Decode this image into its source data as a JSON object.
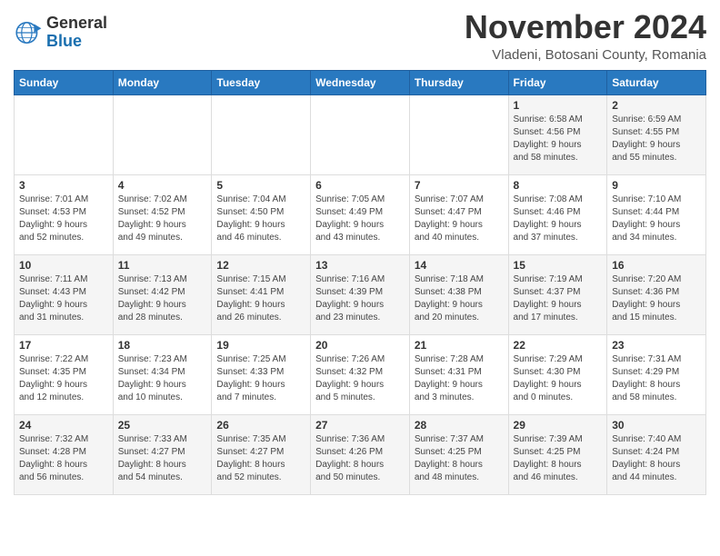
{
  "header": {
    "logo_text_general": "General",
    "logo_text_blue": "Blue",
    "month_title": "November 2024",
    "location": "Vladeni, Botosani County, Romania"
  },
  "days_of_week": [
    "Sunday",
    "Monday",
    "Tuesday",
    "Wednesday",
    "Thursday",
    "Friday",
    "Saturday"
  ],
  "weeks": [
    [
      {
        "day": "",
        "info": ""
      },
      {
        "day": "",
        "info": ""
      },
      {
        "day": "",
        "info": ""
      },
      {
        "day": "",
        "info": ""
      },
      {
        "day": "",
        "info": ""
      },
      {
        "day": "1",
        "info": "Sunrise: 6:58 AM\nSunset: 4:56 PM\nDaylight: 9 hours\nand 58 minutes."
      },
      {
        "day": "2",
        "info": "Sunrise: 6:59 AM\nSunset: 4:55 PM\nDaylight: 9 hours\nand 55 minutes."
      }
    ],
    [
      {
        "day": "3",
        "info": "Sunrise: 7:01 AM\nSunset: 4:53 PM\nDaylight: 9 hours\nand 52 minutes."
      },
      {
        "day": "4",
        "info": "Sunrise: 7:02 AM\nSunset: 4:52 PM\nDaylight: 9 hours\nand 49 minutes."
      },
      {
        "day": "5",
        "info": "Sunrise: 7:04 AM\nSunset: 4:50 PM\nDaylight: 9 hours\nand 46 minutes."
      },
      {
        "day": "6",
        "info": "Sunrise: 7:05 AM\nSunset: 4:49 PM\nDaylight: 9 hours\nand 43 minutes."
      },
      {
        "day": "7",
        "info": "Sunrise: 7:07 AM\nSunset: 4:47 PM\nDaylight: 9 hours\nand 40 minutes."
      },
      {
        "day": "8",
        "info": "Sunrise: 7:08 AM\nSunset: 4:46 PM\nDaylight: 9 hours\nand 37 minutes."
      },
      {
        "day": "9",
        "info": "Sunrise: 7:10 AM\nSunset: 4:44 PM\nDaylight: 9 hours\nand 34 minutes."
      }
    ],
    [
      {
        "day": "10",
        "info": "Sunrise: 7:11 AM\nSunset: 4:43 PM\nDaylight: 9 hours\nand 31 minutes."
      },
      {
        "day": "11",
        "info": "Sunrise: 7:13 AM\nSunset: 4:42 PM\nDaylight: 9 hours\nand 28 minutes."
      },
      {
        "day": "12",
        "info": "Sunrise: 7:15 AM\nSunset: 4:41 PM\nDaylight: 9 hours\nand 26 minutes."
      },
      {
        "day": "13",
        "info": "Sunrise: 7:16 AM\nSunset: 4:39 PM\nDaylight: 9 hours\nand 23 minutes."
      },
      {
        "day": "14",
        "info": "Sunrise: 7:18 AM\nSunset: 4:38 PM\nDaylight: 9 hours\nand 20 minutes."
      },
      {
        "day": "15",
        "info": "Sunrise: 7:19 AM\nSunset: 4:37 PM\nDaylight: 9 hours\nand 17 minutes."
      },
      {
        "day": "16",
        "info": "Sunrise: 7:20 AM\nSunset: 4:36 PM\nDaylight: 9 hours\nand 15 minutes."
      }
    ],
    [
      {
        "day": "17",
        "info": "Sunrise: 7:22 AM\nSunset: 4:35 PM\nDaylight: 9 hours\nand 12 minutes."
      },
      {
        "day": "18",
        "info": "Sunrise: 7:23 AM\nSunset: 4:34 PM\nDaylight: 9 hours\nand 10 minutes."
      },
      {
        "day": "19",
        "info": "Sunrise: 7:25 AM\nSunset: 4:33 PM\nDaylight: 9 hours\nand 7 minutes."
      },
      {
        "day": "20",
        "info": "Sunrise: 7:26 AM\nSunset: 4:32 PM\nDaylight: 9 hours\nand 5 minutes."
      },
      {
        "day": "21",
        "info": "Sunrise: 7:28 AM\nSunset: 4:31 PM\nDaylight: 9 hours\nand 3 minutes."
      },
      {
        "day": "22",
        "info": "Sunrise: 7:29 AM\nSunset: 4:30 PM\nDaylight: 9 hours\nand 0 minutes."
      },
      {
        "day": "23",
        "info": "Sunrise: 7:31 AM\nSunset: 4:29 PM\nDaylight: 8 hours\nand 58 minutes."
      }
    ],
    [
      {
        "day": "24",
        "info": "Sunrise: 7:32 AM\nSunset: 4:28 PM\nDaylight: 8 hours\nand 56 minutes."
      },
      {
        "day": "25",
        "info": "Sunrise: 7:33 AM\nSunset: 4:27 PM\nDaylight: 8 hours\nand 54 minutes."
      },
      {
        "day": "26",
        "info": "Sunrise: 7:35 AM\nSunset: 4:27 PM\nDaylight: 8 hours\nand 52 minutes."
      },
      {
        "day": "27",
        "info": "Sunrise: 7:36 AM\nSunset: 4:26 PM\nDaylight: 8 hours\nand 50 minutes."
      },
      {
        "day": "28",
        "info": "Sunrise: 7:37 AM\nSunset: 4:25 PM\nDaylight: 8 hours\nand 48 minutes."
      },
      {
        "day": "29",
        "info": "Sunrise: 7:39 AM\nSunset: 4:25 PM\nDaylight: 8 hours\nand 46 minutes."
      },
      {
        "day": "30",
        "info": "Sunrise: 7:40 AM\nSunset: 4:24 PM\nDaylight: 8 hours\nand 44 minutes."
      }
    ]
  ]
}
